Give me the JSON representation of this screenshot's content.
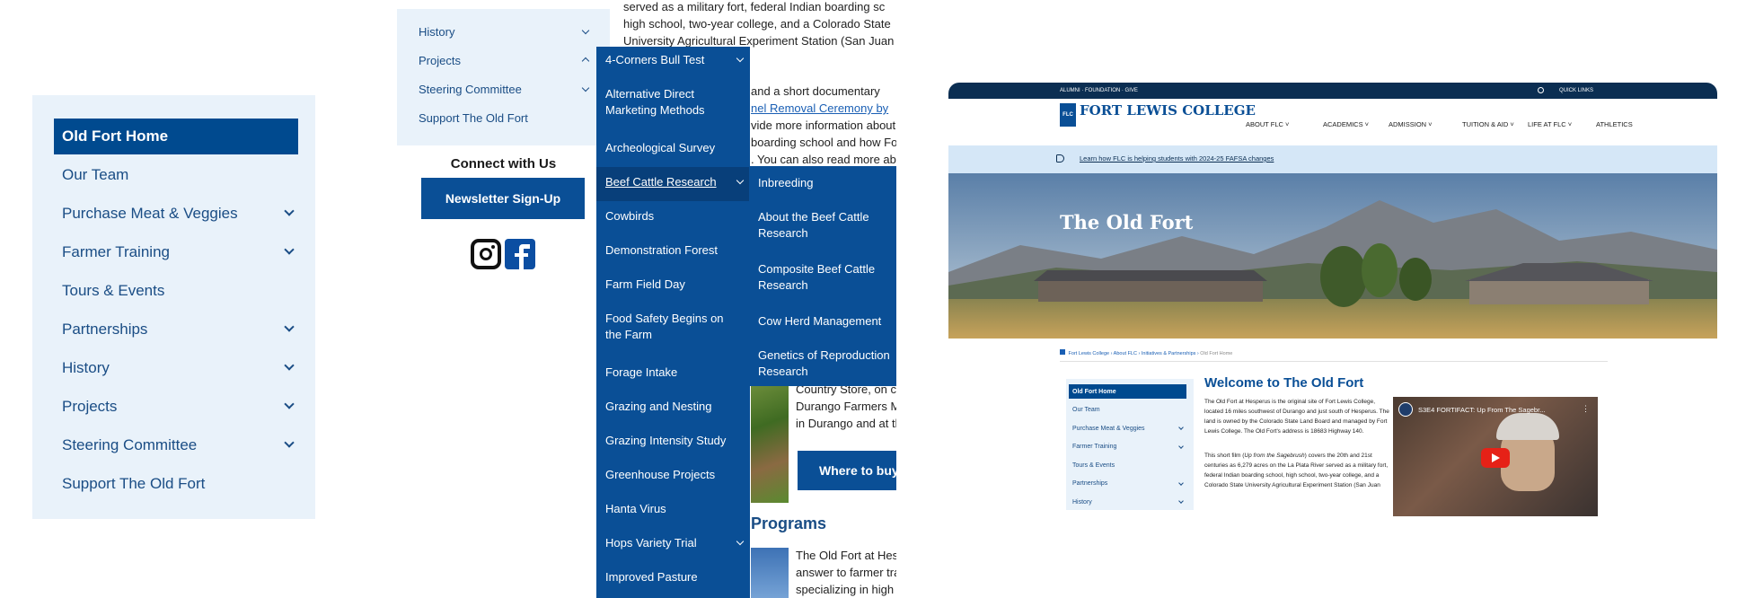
{
  "panel1": {
    "items": [
      {
        "label": "Old Fort Home",
        "active": true,
        "chevron": false
      },
      {
        "label": "Our Team",
        "active": false,
        "chevron": false
      },
      {
        "label": "Purchase Meat & Veggies",
        "active": false,
        "chevron": true
      },
      {
        "label": "Farmer Training",
        "active": false,
        "chevron": true
      },
      {
        "label": "Tours & Events",
        "active": false,
        "chevron": false
      },
      {
        "label": "Partnerships",
        "active": false,
        "chevron": true
      },
      {
        "label": "History",
        "active": false,
        "chevron": true
      },
      {
        "label": "Projects",
        "active": false,
        "chevron": true
      },
      {
        "label": "Steering Committee",
        "active": false,
        "chevron": true
      },
      {
        "label": "Support The Old Fort",
        "active": false,
        "chevron": false
      }
    ]
  },
  "panel2": {
    "sidebar": {
      "history": "History",
      "projects": "Projects",
      "steering": "Steering Committee",
      "support": "Support The Old Fort"
    },
    "connect_title": "Connect with Us",
    "newsletter_button": "Newsletter Sign-Up",
    "body_lines": [
      "served as a military fort, federal Indian boarding sc",
      "high school, two-year college, and a Colorado State",
      "University Agricultural Experiment Station (San Juan"
    ],
    "body_lines2": [
      "and a short documentary",
      "nel Removal Ceremony by",
      "vide more information about",
      "boarding school and how For",
      ". You can also read more abo"
    ],
    "country_lines": [
      "Country Store, on ca",
      "Durango Farmers Ma",
      "in Durango and at th"
    ],
    "where_button": "Where to buy",
    "programs_heading": "Programs",
    "programs_lines": [
      "The Old Fort at Hesp",
      "answer to farmer tra",
      "specializing in high"
    ],
    "dropdown1": [
      {
        "label": "4-Corners Bull Test",
        "chevron": true
      },
      {
        "label": "Alternative Direct Marketing Methods",
        "chevron": false
      },
      {
        "label": "Archeological Survey",
        "chevron": false
      },
      {
        "label": "Beef Cattle Research",
        "chevron": true,
        "active": true
      },
      {
        "label": "Cowbirds",
        "chevron": false
      },
      {
        "label": "Demonstration Forest",
        "chevron": false
      },
      {
        "label": "Farm Field Day",
        "chevron": false
      },
      {
        "label": "Food Safety Begins on the Farm",
        "chevron": false
      },
      {
        "label": "Forage Intake",
        "chevron": false
      },
      {
        "label": "Grazing and Nesting",
        "chevron": false
      },
      {
        "label": "Grazing Intensity Study",
        "chevron": false
      },
      {
        "label": "Greenhouse Projects",
        "chevron": false
      },
      {
        "label": "Hanta Virus",
        "chevron": false
      },
      {
        "label": "Hops Variety Trial",
        "chevron": true
      },
      {
        "label": "Improved Pasture",
        "chevron": false
      }
    ],
    "dropdown2": [
      "Inbreeding",
      "About the Beef Cattle Research",
      "Composite Beef Cattle Research",
      "Cow Herd Management",
      "Genetics of Reproduction Research"
    ]
  },
  "panel3": {
    "topbar_links": "ALUMNI · FOUNDATION · GIVE",
    "quick_links": "QUICK LINKS",
    "logo_text": "FORT LEWIS COLLEGE",
    "logo_mark": "FLC",
    "nav": [
      "ABOUT FLC",
      "ACADEMICS",
      "ADMISSION",
      "TUITION & AID",
      "LIFE AT FLC",
      "ATHLETICS"
    ],
    "banner_text": "Learn how FLC is helping students with 2024-25 FAFSA changes",
    "hero_title": "The Old Fort",
    "breadcrumb": [
      "Fort Lewis College",
      "About FLC",
      "Initiatives & Partnerships",
      "Old Fort Home"
    ],
    "side_items": [
      {
        "label": "Old Fort Home",
        "active": true,
        "chevron": false
      },
      {
        "label": "Our Team",
        "active": false,
        "chevron": false
      },
      {
        "label": "Purchase Meat & Veggies",
        "active": false,
        "chevron": true
      },
      {
        "label": "Farmer Training",
        "active": false,
        "chevron": true
      },
      {
        "label": "Tours & Events",
        "active": false,
        "chevron": false
      },
      {
        "label": "Partnerships",
        "active": false,
        "chevron": true
      },
      {
        "label": "History",
        "active": false,
        "chevron": true
      }
    ],
    "welcome_title": "Welcome to The Old Fort",
    "para1": "The Old Fort at Hesperus is the original site of Fort Lewis College, located 16 miles southwest of Durango and just south of Hesperus. The land is owned by the Colorado State Land Board and managed by Fort Lewis College. The Old Fort's address is 18683 Highway 140.",
    "para2_pre": "This short film (",
    "para2_em": "Up from the Sagebrush",
    "para2_post": ") covers the 20th and 21st centuries as 6,279 acres on the La Plata River served as a military fort, federal Indian boarding school, high school, two-year college, and a Colorado State University Agricultural Experiment Station (San Juan",
    "video_title": "S3E4 FORTIFACT: Up From The Sagebr..."
  },
  "colors": {
    "brand_blue": "#004a8f",
    "dropdown_blue": "#0a4f96",
    "light_panel": "#e9f2fa",
    "top_bar": "#0b2e52",
    "banner": "#d5e7f7"
  }
}
